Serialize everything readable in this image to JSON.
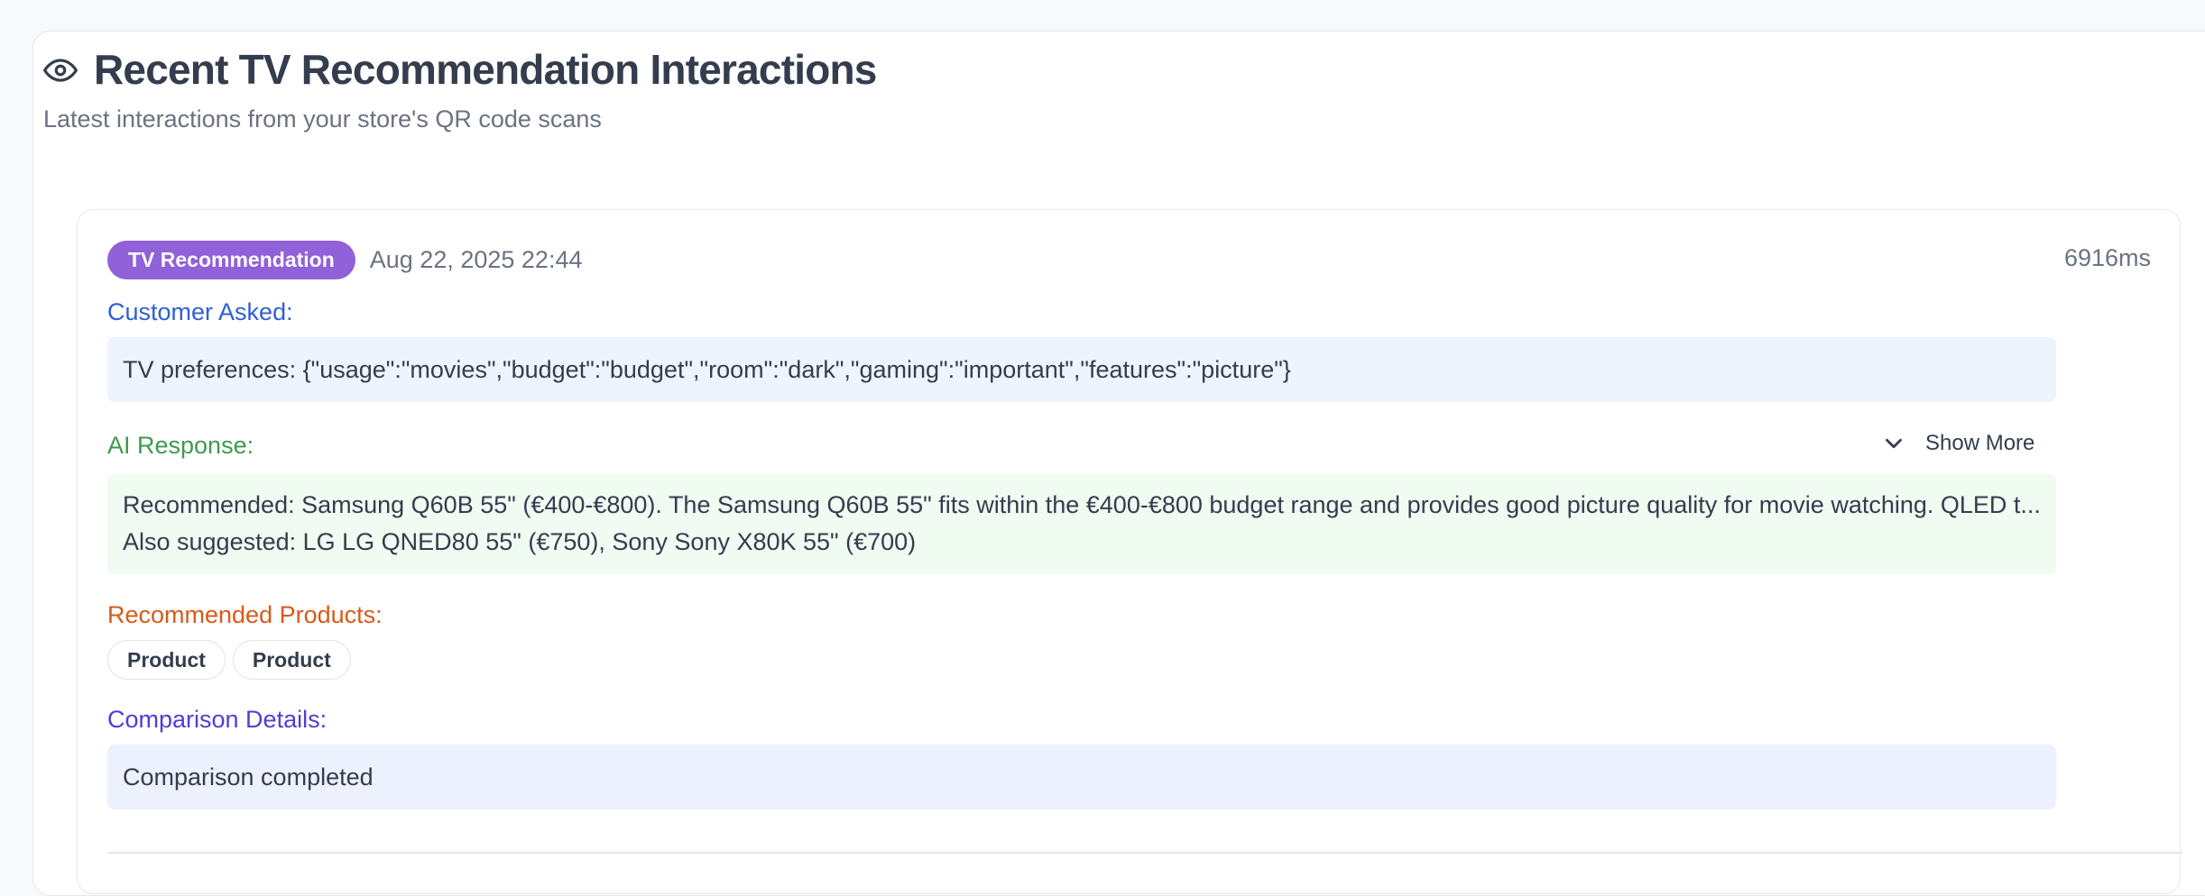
{
  "header": {
    "icon": "eye-icon",
    "title": "Recent TV Recommendation Interactions",
    "subtitle": "Latest interactions from your store's QR code scans"
  },
  "interaction": {
    "badge": "TV Recommendation",
    "badge_color": "#9061d9",
    "timestamp": "Aug 22, 2025 22:44",
    "duration": "6916ms",
    "customer_label": "Customer Asked:",
    "customer_text": "TV preferences: {\"usage\":\"movies\",\"budget\":\"budget\",\"room\":\"dark\",\"gaming\":\"important\",\"features\":\"picture\"}",
    "ai_label": "AI Response:",
    "show_more_icon": "chevron-down-icon",
    "show_more_label": "Show More",
    "ai_text": "Recommended: Samsung Q60B 55\" (€400-€800). The Samsung Q60B 55\" fits within the €400-€800 budget range and provides good picture quality for movie watching. QLED t... Also suggested: LG LG QNED80 55\" (€750), Sony Sony X80K 55\" (€700)",
    "products_label": "Recommended Products:",
    "products": [
      "Product",
      "Product"
    ],
    "comparison_label": "Comparison Details:",
    "comparison_text": "Comparison completed"
  },
  "colors": {
    "customer_label": "#2e5fd6",
    "ai_label": "#3e9a4c",
    "products_label": "#d65a1c",
    "comparison_label": "#4c3fd8"
  }
}
